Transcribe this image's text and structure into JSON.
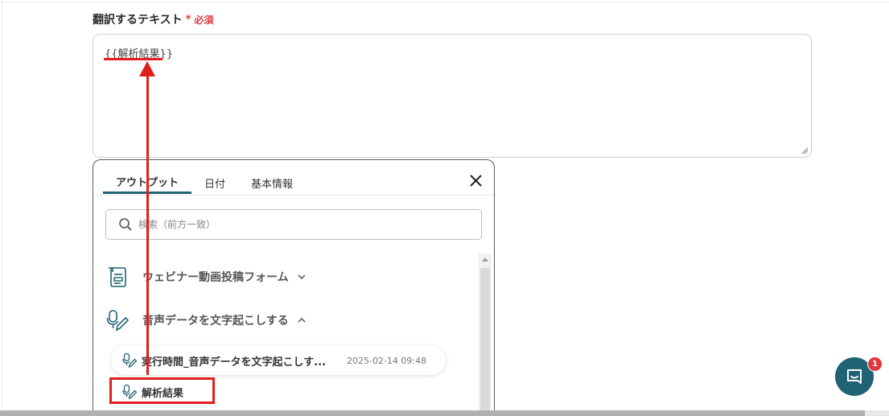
{
  "field": {
    "label": "翻訳するテキスト",
    "required_star": "*",
    "required_text": "必須",
    "value": "{{解析結果}}"
  },
  "panel": {
    "tabs": [
      {
        "label": "アウトプット",
        "active": true
      },
      {
        "label": "日付",
        "active": false
      },
      {
        "label": "基本情報",
        "active": false
      }
    ],
    "search_placeholder": "検索（前方一致）",
    "groups": [
      {
        "label": "ウェビナー動画投稿フォーム",
        "icon": "form-icon",
        "expanded": false
      },
      {
        "label": "音声データを文字起こしする",
        "icon": "mic-pen-icon",
        "expanded": true
      }
    ],
    "items": [
      {
        "label": "実行時間_音声データを文字起こしす...",
        "timestamp": "2025-02-14 09:48",
        "icon": "mic-pen-icon"
      },
      {
        "label": "解析結果",
        "icon": "mic-pen-icon"
      }
    ]
  },
  "chat": {
    "badge_count": "1",
    "icon": "chat-bubble-icon"
  },
  "colors": {
    "accent": "#1f6374",
    "required": "#e0383e",
    "annotation": "#e0201e"
  }
}
